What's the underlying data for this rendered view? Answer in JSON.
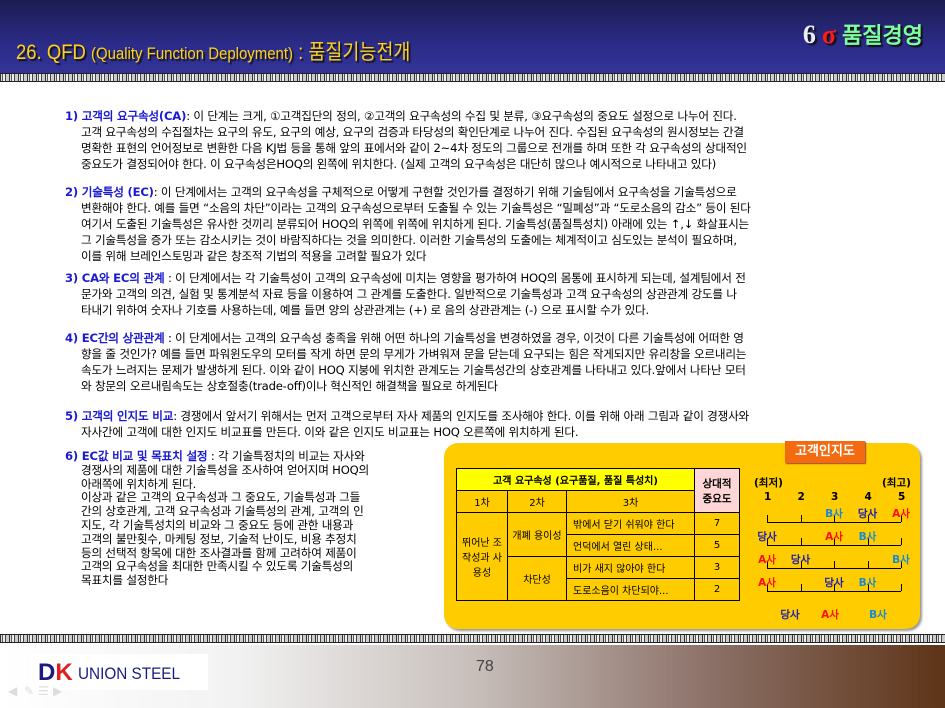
{
  "header": {
    "title_main": "26. QFD ",
    "title_sub": "(Quality Function Deployment)",
    "title_tail": " : 품질기능전개",
    "brand_six": "6",
    "brand_sigma": "σ",
    "brand_text": "품질경영"
  },
  "paragraphs": [
    {
      "heading": "1) 고객의 요구속성(CA)",
      "lines": [
        ": 이 단계는 크게, ①고객집단의 정의, ②고객의 요구속성의 수집 및 분류, ③요구속성의 중요도 설정으로 나누어 진다.",
        "고객 요구속성의 수집절차는 요구의 유도, 요구의 예상, 요구의 검증과 타당성의 확인단계로 나누어 진다. 수집된 요구속성의 원시정보는 간결",
        "명확한 표현의 언어정보로 변환한 다음 KJ법 등을 통해 앞의 표에서와 같이 2~4차 정도의 그룹으로 전개를 하며 또한 각 요구속성의 상대적인",
        "중요도가 결정되어야 한다. 이 요구속성은HOQ의 왼쪽에 위치한다. (실제 고객의 요구속성은 대단히 많으나 예시적으로 나타내고 있다)"
      ]
    },
    {
      "heading": "2) 기술특성 (EC)",
      "lines": [
        ": 이 단계에서는 고객의 요구속성을 구체적으로 어떻게 구현할 것인가를 결정하기 위해 기술팀에서 요구속성을 기술특성으로",
        "변환해야 한다. 예를 들면 “소음의 차단”이라는 고객의 요구속성으로부터 도출될 수 있는 기술특성은 “밀폐성”과 “도로소음의 감소” 등이 된다",
        "여기서 도출된 기술특성은 유사한 것끼리 분류되어 HOQ의 위쪽에 위쪽에 위치하게 된다. 기술특성(품질특성치) 아래에 있는 ↑,↓ 화살표시는",
        "그 기술특성을 증가 또는 감소시키는 것이 바람직하다는 것을 의미한다. 이러한 기술특성의 도출에는 체계적이고 심도있는 분석이 필요하며,",
        "이를 위해 브레인스토밍과 같은 창조적 기법의 적용을 고려할 필요가 있다"
      ]
    },
    {
      "heading": "3) CA와 EC의 관계",
      "lines": [
        " : 이 단계에서는 각 기술특성이 고객의 요구속성에 미치는 영향을 평가하여 HOQ의 몸통에 표시하게 되는데, 설계팀에서 전",
        "문가와 고객의 의견, 실험 및 통계분석 자료 등을 이용하여 그 관계를 도출한다. 일반적으로 기술특성과 고객 요구속성의 상관관계 강도를 나",
        "타내기 위하여 숫자나 기호를 사용하는데, 예를 들면 양의 상관관계는 (+) 로 음의 상관관계는 (-) 으로 표시할 수가 있다."
      ]
    },
    {
      "heading": "4) EC간의 상관관계",
      "lines": [
        " : 이 단계에서는 고객의 요구속성 충족을 위해 어떤 하나의 기술특성을 변경하였을 경우, 이것이 다른 기술특성에 어떠한 영",
        "향을 줄 것인가? 예를 들면 파워윈도우의 모터를 작게 하면 문의 무게가 가벼워져 문을 닫는데 요구되는 힘은 작게되지만 유리창을 오르내리는",
        "속도가 느려지는 문제가 발생하게 된다. 이와 같이 HOQ 지붕에 위치한 관계도는 기술특성간의 상호관계를 나타내고 있다.앞에서 나타난 모터",
        "와 창문의 오르내림속도는 상호절충(trade-off)이나 혁신적인 해결책을 필요로 하게된다"
      ]
    },
    {
      "heading": "5) 고객의 인지도 비교",
      "lines": [
        ": 경쟁에서 앞서기 위해서는 먼저 고객으로부터 자사 제품의 인지도를 조사해야 한다. 이를 위해 아래 그림과 같이 경쟁사와",
        "자사간에 고객에 대한 인지도 비교표를 만든다. 이와 같은 인지도 비교표는 HOQ 오른쪽에 위치하게 된다."
      ]
    },
    {
      "heading": "6) EC값 비교 및 목표치 설정",
      "lines": [
        " : 각 기술특정치의 비교는 자사와",
        "경쟁사의 제품에 대한 기술특성을 조사하여 얻어지며 HOQ의",
        "아래쪽에 위치하게 된다.",
        "이상과 같은 고객의 요구속성과 그 중요도, 기술특성과 그들",
        "간의 상호관계, 고객 요구속성과 기술특성의 관계, 고객의 인",
        "지도, 각 기술특성치의 비교와 그 중요도 등에 관한 내용과",
        "고객의 불만횟수, 마케팅 정보, 기술적 난이도, 비용 추정치",
        "등의 선택적 항목에 대한 조사결과를 함께 고려하여 제품이",
        "고객의 요구속성을 최대한 만족시킬 수 있도록 기술특성의",
        "목표치를 설정한다"
      ]
    }
  ],
  "figure": {
    "tab": "고객인지도",
    "table": {
      "header": "고객 요구속성 (요구품질, 품질 특성치)",
      "importance_header": "상대적 중요도",
      "levels": [
        "1차",
        "2차",
        "3차"
      ],
      "level1": "뛰어난 조작성과 사용성",
      "groups": [
        {
          "name": "개폐 용이성",
          "items": [
            {
              "text": "밖에서 닫기 쉬워야 한다",
              "importance": "7"
            },
            {
              "text": "언덕에서 열린 상태...",
              "importance": "5"
            }
          ]
        },
        {
          "name": "차단성",
          "items": [
            {
              "text": "비가 새지 않아야 한다",
              "importance": "3"
            },
            {
              "text": "도로소음이 차단되야...",
              "importance": "2"
            }
          ]
        }
      ]
    },
    "scale": {
      "low": "(최저)",
      "high": "(최고)",
      "ticks": [
        "1",
        "2",
        "3",
        "4",
        "5"
      ],
      "companies": [
        {
          "key": "our",
          "label": "당사",
          "color": "#2020b0"
        },
        {
          "key": "a",
          "label": "A사",
          "color": "#ff1010"
        },
        {
          "key": "b",
          "label": "B사",
          "color": "#1a8ad0"
        }
      ],
      "ratings": [
        {
          "our": 4,
          "a": 5,
          "b": 3
        },
        {
          "our": 1,
          "a": 3,
          "b": 4
        },
        {
          "our": 2,
          "a": 1,
          "b": 5
        },
        {
          "our": 3,
          "a": 1,
          "b": 4
        }
      ]
    }
  },
  "footer": {
    "logo_d": "D",
    "logo_k": "K",
    "logo_text": "UNION STEEL",
    "page": "78"
  }
}
